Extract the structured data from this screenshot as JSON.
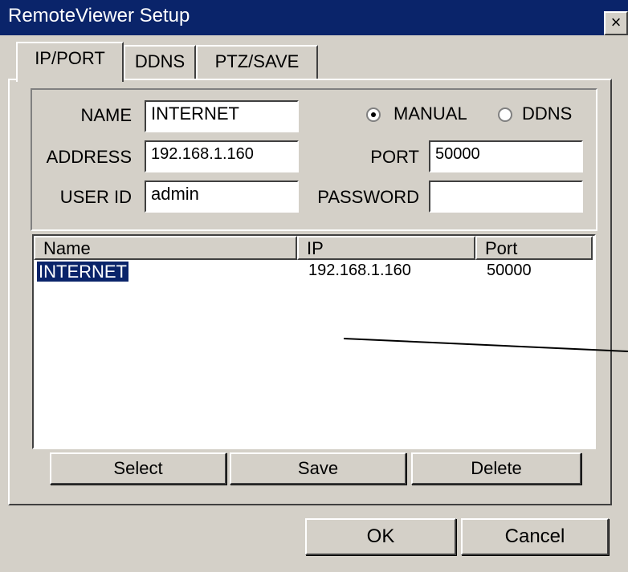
{
  "window": {
    "title": "RemoteViewer Setup",
    "close_glyph": "×"
  },
  "tabs": [
    {
      "label": "IP/PORT",
      "active": true
    },
    {
      "label": "DDNS",
      "active": false
    },
    {
      "label": "PTZ/SAVE",
      "active": false
    }
  ],
  "form": {
    "name_label": "NAME",
    "name_value": "INTERNET",
    "address_label": "ADDRESS",
    "address_value": "192.168.1.160",
    "userid_label": "USER ID",
    "userid_value": "admin",
    "port_label": "PORT",
    "port_value": "50000",
    "password_label": "PASSWORD",
    "password_value": "",
    "mode_options": [
      {
        "label": "MANUAL",
        "selected": true
      },
      {
        "label": "DDNS",
        "selected": false
      }
    ]
  },
  "list": {
    "columns": [
      "Name",
      "IP",
      "Port"
    ],
    "rows": [
      {
        "name": "INTERNET",
        "ip": "192.168.1.160",
        "port": "50000",
        "selected": true
      }
    ]
  },
  "actions": {
    "select": "Select",
    "save": "Save",
    "delete": "Delete"
  },
  "footer": {
    "ok": "OK",
    "cancel": "Cancel"
  },
  "colors": {
    "titlebar": "#0a246a",
    "face": "#d4d0c8",
    "selection": "#0a246a"
  }
}
